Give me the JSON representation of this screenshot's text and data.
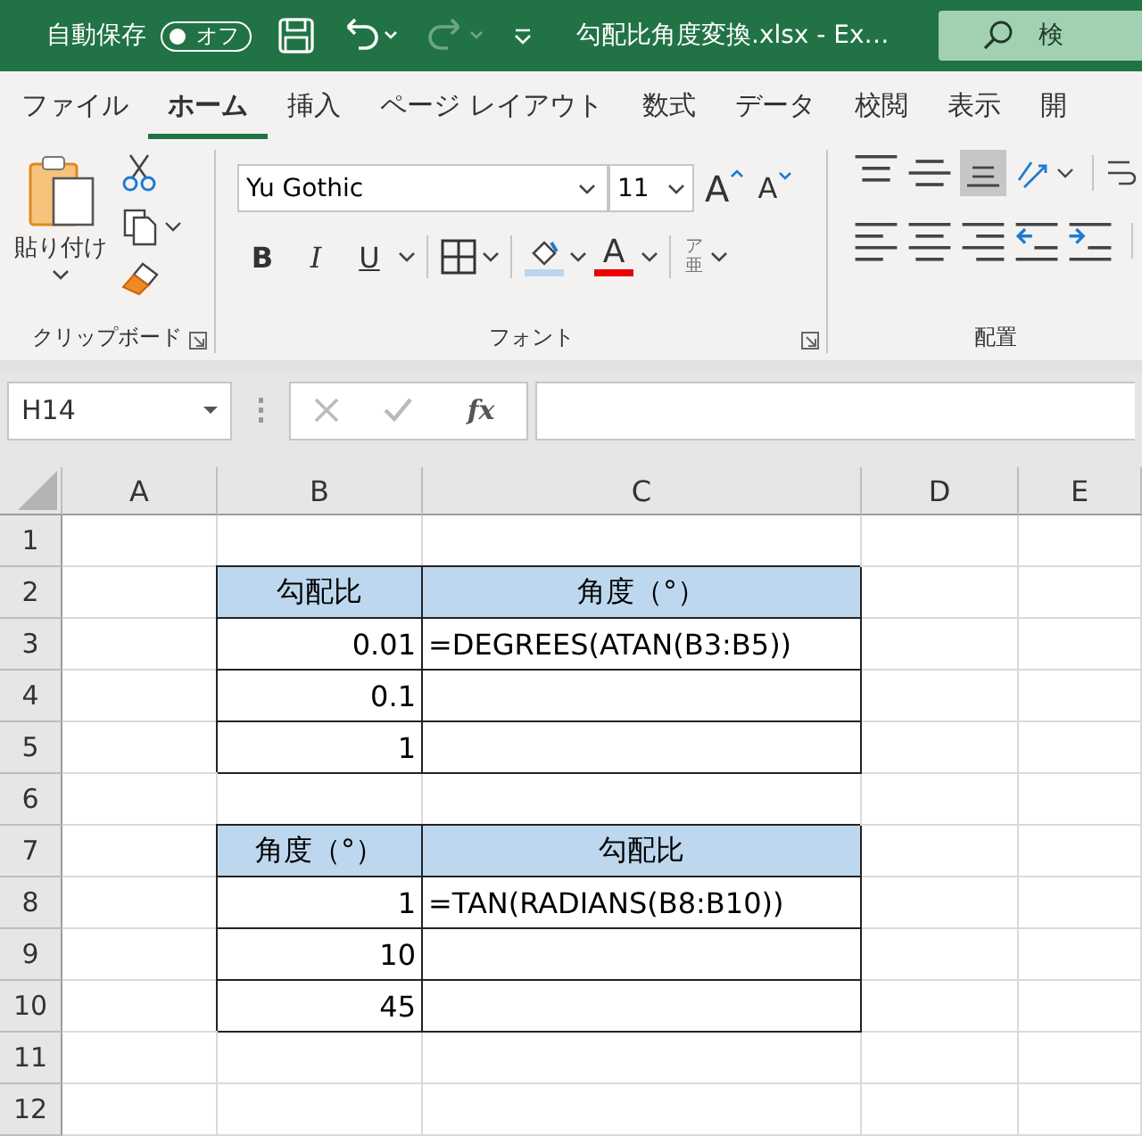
{
  "title_bar": {
    "autosave_label": "自動保存",
    "autosave_toggle": {
      "label": "オフ",
      "on": false
    },
    "redo_disabled": true,
    "file_title": "勾配比角度変換.xlsx  -  Ex…",
    "search": {
      "placeholder": "検"
    }
  },
  "tabs": [
    {
      "label": "ファイル",
      "selected": false
    },
    {
      "label": "ホーム",
      "selected": true
    },
    {
      "label": "挿入",
      "selected": false
    },
    {
      "label": "ページ レイアウト",
      "selected": false
    },
    {
      "label": "数式",
      "selected": false
    },
    {
      "label": "データ",
      "selected": false
    },
    {
      "label": "校閲",
      "selected": false
    },
    {
      "label": "表示",
      "selected": false
    },
    {
      "label": "開",
      "selected": false
    }
  ],
  "ribbon": {
    "clipboard": {
      "paste_label": "貼り付け",
      "group_label": "クリップボード"
    },
    "font": {
      "font_name": "Yu Gothic",
      "font_size": "11",
      "grow": "A",
      "shrink": "A",
      "bold": "B",
      "italic": "I",
      "underline": "U",
      "font_color": "A",
      "phonetic_top": "ア",
      "phonetic_bottom": "亜",
      "group_label": "フォント"
    },
    "alignment": {
      "group_label": "配置",
      "bottom_align_selected": true
    }
  },
  "formula_bar": {
    "name_box": "H14",
    "fx": "fx"
  },
  "sheet": {
    "columns": [
      "A",
      "B",
      "C",
      "D",
      "E"
    ],
    "rows": [
      {
        "number": "1",
        "cells": [
          {
            "kind": "plain",
            "text": ""
          },
          {
            "kind": "plain",
            "text": ""
          },
          {
            "kind": "plain",
            "text": ""
          },
          {
            "kind": "plain",
            "text": ""
          },
          {
            "kind": "plain",
            "text": ""
          }
        ]
      },
      {
        "number": "2",
        "cells": [
          {
            "kind": "plain",
            "text": ""
          },
          {
            "kind": "head",
            "text": "勾配比"
          },
          {
            "kind": "head",
            "text": "角度（°）"
          },
          {
            "kind": "plain",
            "text": ""
          },
          {
            "kind": "plain",
            "text": ""
          }
        ]
      },
      {
        "number": "3",
        "cells": [
          {
            "kind": "plain",
            "text": ""
          },
          {
            "kind": "number",
            "text": "0.01"
          },
          {
            "kind": "formula",
            "text": "=DEGREES(ATAN(B3:B5))"
          },
          {
            "kind": "plain",
            "text": ""
          },
          {
            "kind": "plain",
            "text": ""
          }
        ]
      },
      {
        "number": "4",
        "cells": [
          {
            "kind": "plain",
            "text": ""
          },
          {
            "kind": "number",
            "text": "0.1"
          },
          {
            "kind": "formula",
            "text": ""
          },
          {
            "kind": "plain",
            "text": ""
          },
          {
            "kind": "plain",
            "text": ""
          }
        ]
      },
      {
        "number": "5",
        "cells": [
          {
            "kind": "plain",
            "text": ""
          },
          {
            "kind": "number",
            "text": "1"
          },
          {
            "kind": "formula",
            "text": ""
          },
          {
            "kind": "plain",
            "text": ""
          },
          {
            "kind": "plain",
            "text": ""
          }
        ]
      },
      {
        "number": "6",
        "cells": [
          {
            "kind": "plain",
            "text": ""
          },
          {
            "kind": "plain",
            "text": ""
          },
          {
            "kind": "plain",
            "text": ""
          },
          {
            "kind": "plain",
            "text": ""
          },
          {
            "kind": "plain",
            "text": ""
          }
        ]
      },
      {
        "number": "7",
        "cells": [
          {
            "kind": "plain",
            "text": ""
          },
          {
            "kind": "head",
            "text": "角度（°）"
          },
          {
            "kind": "head",
            "text": "勾配比"
          },
          {
            "kind": "plain",
            "text": ""
          },
          {
            "kind": "plain",
            "text": ""
          }
        ]
      },
      {
        "number": "8",
        "cells": [
          {
            "kind": "plain",
            "text": ""
          },
          {
            "kind": "number",
            "text": "1"
          },
          {
            "kind": "formula",
            "text": "=TAN(RADIANS(B8:B10))"
          },
          {
            "kind": "plain",
            "text": ""
          },
          {
            "kind": "plain",
            "text": ""
          }
        ]
      },
      {
        "number": "9",
        "cells": [
          {
            "kind": "plain",
            "text": ""
          },
          {
            "kind": "number",
            "text": "10"
          },
          {
            "kind": "formula",
            "text": ""
          },
          {
            "kind": "plain",
            "text": ""
          },
          {
            "kind": "plain",
            "text": ""
          }
        ]
      },
      {
        "number": "10",
        "cells": [
          {
            "kind": "plain",
            "text": ""
          },
          {
            "kind": "number",
            "text": "45"
          },
          {
            "kind": "formula",
            "text": ""
          },
          {
            "kind": "plain",
            "text": ""
          },
          {
            "kind": "plain",
            "text": ""
          }
        ]
      },
      {
        "number": "11",
        "cells": [
          {
            "kind": "plain",
            "text": ""
          },
          {
            "kind": "plain",
            "text": ""
          },
          {
            "kind": "plain",
            "text": ""
          },
          {
            "kind": "plain",
            "text": ""
          },
          {
            "kind": "plain",
            "text": ""
          }
        ]
      },
      {
        "number": "12",
        "cells": [
          {
            "kind": "plain",
            "text": ""
          },
          {
            "kind": "plain",
            "text": ""
          },
          {
            "kind": "plain",
            "text": ""
          },
          {
            "kind": "plain",
            "text": ""
          },
          {
            "kind": "plain",
            "text": ""
          }
        ]
      }
    ]
  }
}
